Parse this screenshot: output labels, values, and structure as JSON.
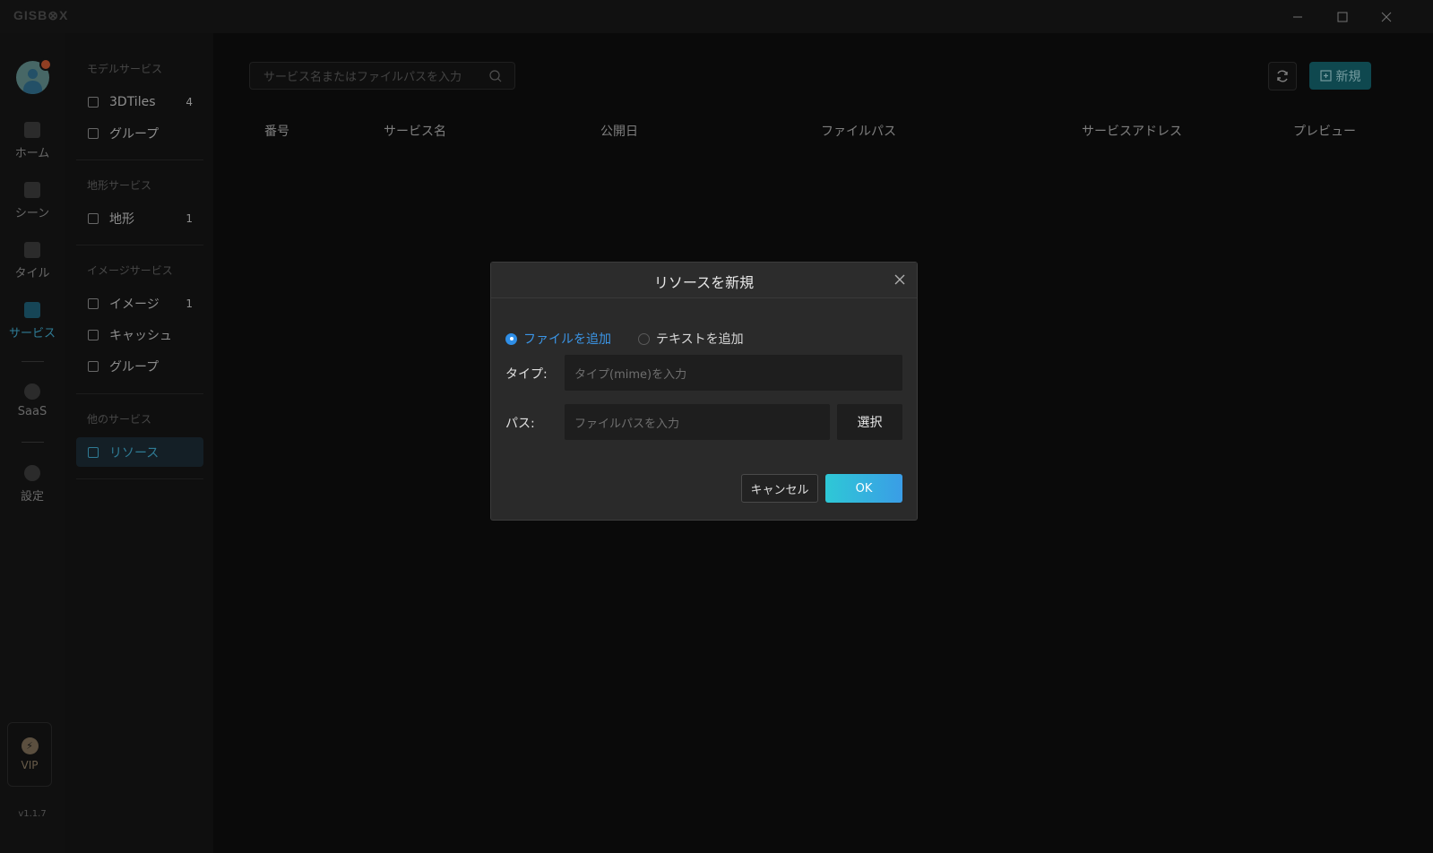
{
  "app": {
    "logo": "GISB⊗X",
    "version": "v1.1.7"
  },
  "window_controls": {
    "minimize_icon": "minimize-icon",
    "maximize_icon": "maximize-icon",
    "close_icon": "close-icon"
  },
  "rail": {
    "items": [
      {
        "label": "ホーム",
        "icon": "home-icon"
      },
      {
        "label": "シーン",
        "icon": "scene-icon"
      },
      {
        "label": "タイル",
        "icon": "tile-icon"
      },
      {
        "label": "サービス",
        "icon": "service-icon",
        "active": true
      },
      {
        "label": "SaaS",
        "icon": "lock-icon"
      },
      {
        "label": "設定",
        "icon": "settings-icon"
      }
    ],
    "vip_label": "VIP"
  },
  "sidebar": {
    "groups": [
      {
        "title": "モデルサービス",
        "items": [
          {
            "label": "3DTiles",
            "count": "4"
          },
          {
            "label": "グループ",
            "count": ""
          }
        ]
      },
      {
        "title": "地形サービス",
        "items": [
          {
            "label": "地形",
            "count": "1"
          }
        ]
      },
      {
        "title": "イメージサービス",
        "items": [
          {
            "label": "イメージ",
            "count": "1"
          },
          {
            "label": "キャッシュ",
            "count": ""
          },
          {
            "label": "グループ",
            "count": ""
          }
        ]
      },
      {
        "title": "他のサービス",
        "items": [
          {
            "label": "リソース",
            "count": "",
            "active": true
          }
        ]
      }
    ]
  },
  "main": {
    "search_placeholder": "サービス名またはファイルパスを入力",
    "new_button": "新規",
    "columns": [
      "番号",
      "サービス名",
      "公開日",
      "ファイルパス",
      "サービスアドレス",
      "プレビュー"
    ]
  },
  "dialog": {
    "title": "リソースを新規",
    "radio_file": "ファイルを追加",
    "radio_text": "テキストを追加",
    "type_label": "タイプ:",
    "type_placeholder": "タイプ(mime)を入力",
    "path_label": "パス:",
    "path_placeholder": "ファイルパスを入力",
    "select_button": "選択",
    "cancel_button": "キャンセル",
    "ok_button": "OK"
  },
  "colors": {
    "accent": "#3fa5c7",
    "radio_active": "#2f8ee6",
    "new_button_bg": "#14606a"
  }
}
